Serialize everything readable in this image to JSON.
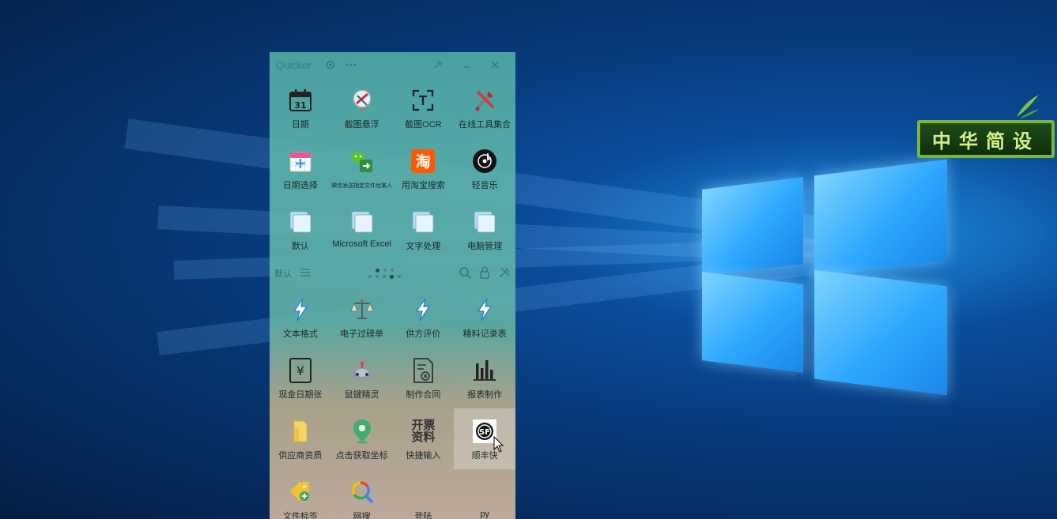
{
  "panel": {
    "title": "Quicker",
    "gear_icon": "gear-icon",
    "more_icon": "more-dots-icon",
    "pin_icon": "pin-icon",
    "close_icon": "close-icon"
  },
  "top_grid": [
    {
      "label": "日期",
      "icon": "calendar-31-icon"
    },
    {
      "label": "截图悬浮",
      "icon": "screenshot-float-icon"
    },
    {
      "label": "截图OCR",
      "icon": "ocr-frame-icon"
    },
    {
      "label": "在线工具集合",
      "icon": "tools-icon"
    },
    {
      "label": "日期选择",
      "icon": "calendar-pick-icon"
    },
    {
      "label": "微信发送指定文件给某人",
      "icon": "wechat-file-icon"
    },
    {
      "label": "用淘宝搜索",
      "icon": "taobao-icon"
    },
    {
      "label": "轻音乐",
      "icon": "music-disc-icon"
    },
    {
      "label": "默认",
      "icon": "stack-icon"
    },
    {
      "label": "Microsoft Excel",
      "icon": "stack-icon"
    },
    {
      "label": "文字处理",
      "icon": "stack-icon"
    },
    {
      "label": "电脑管理",
      "icon": "stack-icon"
    }
  ],
  "divider": {
    "label": "默认",
    "menu_icon": "menu-icon",
    "search_icon": "search-icon",
    "lock_icon": "lock-icon",
    "settings_icon": "wrench-icon"
  },
  "bottom_grid": [
    {
      "label": "文本格式",
      "icon": "lightning-icon"
    },
    {
      "label": "电子过磅单",
      "icon": "scale-icon"
    },
    {
      "label": "供方评价",
      "icon": "lightning-icon"
    },
    {
      "label": "精料记录表",
      "icon": "lightning-icon"
    },
    {
      "label": "现金日期张",
      "icon": "yuan-bill-icon"
    },
    {
      "label": "鼠键精灵",
      "icon": "mouse-sprite-icon"
    },
    {
      "label": "制作合同",
      "icon": "contract-icon"
    },
    {
      "label": "报表制作",
      "icon": "bar-chart-icon"
    },
    {
      "label": "供应商资质",
      "icon": "folder-icon"
    },
    {
      "label": "点击获取坐标",
      "icon": "location-pin-icon"
    },
    {
      "label": "快捷输入",
      "icon": "invoice-text-icon",
      "icon_text": "开票\n资料"
    },
    {
      "label": "顺丰快",
      "icon": "sf-express-icon",
      "icon_text": "SF"
    },
    {
      "label": "文件标签",
      "icon": "tag-add-icon"
    },
    {
      "label": "网搜",
      "icon": "google-search-icon"
    },
    {
      "label": "登陆",
      "icon": ""
    },
    {
      "label": "py",
      "icon": ""
    }
  ],
  "desktop": {
    "sign_text": "中华简设"
  },
  "colors": {
    "panel_top": "#50aaa5",
    "panel_bottom": "#cdb4a0",
    "desktop_blue": "#0a4d9a",
    "sign_border": "#7fb43a"
  }
}
